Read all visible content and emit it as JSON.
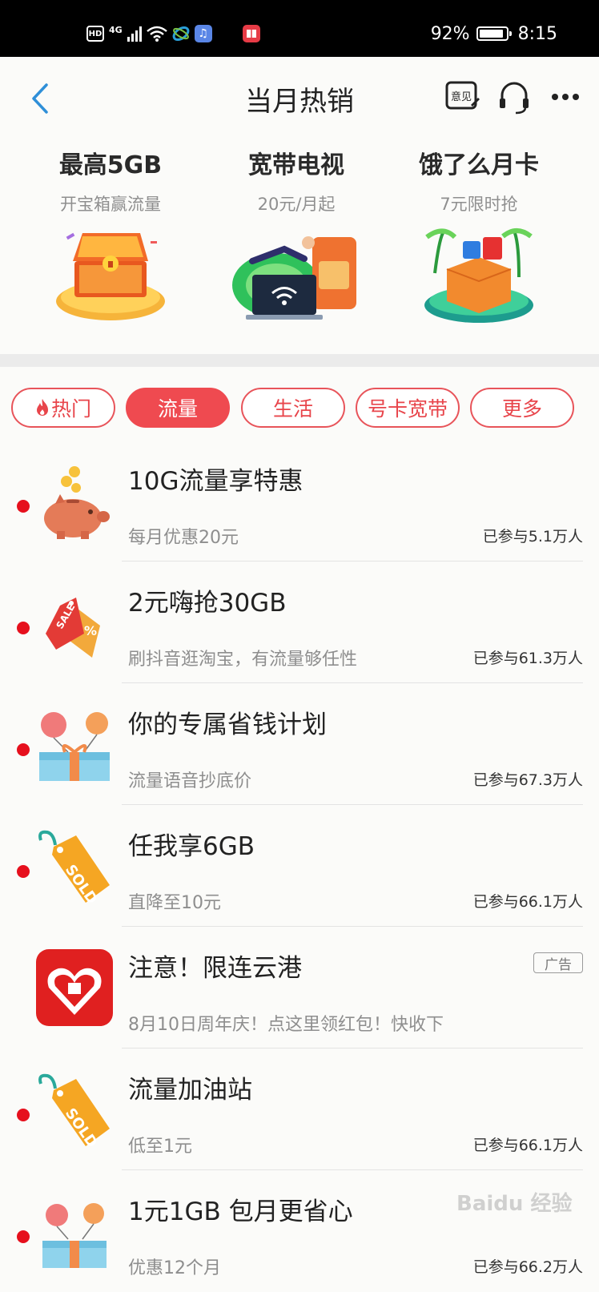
{
  "status_bar": {
    "left": [
      "HD",
      "4G"
    ],
    "battery": "92%",
    "battery_level": 0.92,
    "time": "8:15"
  },
  "header": {
    "title": "当月热销",
    "icons": [
      "back-icon",
      "feedback-icon",
      "headset-icon",
      "more-icon"
    ],
    "feedback_icon_text": "意见"
  },
  "promos": [
    {
      "title": "最高5GB",
      "subtitle": "开宝箱赢流量"
    },
    {
      "title": "宽带电视",
      "subtitle": "20元/月起"
    },
    {
      "title": "饿了么月卡",
      "subtitle": "7元限时抢"
    }
  ],
  "tabs": [
    {
      "label": "热门",
      "active": false,
      "icon": "flame-icon"
    },
    {
      "label": "流量",
      "active": true
    },
    {
      "label": "生活",
      "active": false
    },
    {
      "label": "号卡宽带",
      "active": false
    },
    {
      "label": "更多",
      "active": false
    }
  ],
  "items": [
    {
      "title": "10G流量享特惠",
      "desc": "每月优惠20元",
      "stat": "已参与5.1万人",
      "icon": "piggy-bank-icon"
    },
    {
      "title": "2元嗨抢30GB",
      "desc": "刷抖音逛淘宝，有流量够任性",
      "stat": "已参与61.3万人",
      "icon": "sale-tag-icon"
    },
    {
      "title": "你的专属省钱计划",
      "desc": "流量语音抄底价",
      "stat": "已参与67.3万人",
      "icon": "gift-balloons-icon"
    },
    {
      "title": "任我享6GB",
      "desc": "直降至10元",
      "stat": "已参与66.1万人",
      "icon": "sold-tag-icon"
    },
    {
      "title": "注意！限连云港",
      "desc": "8月10日周年庆！点这里领红包！快收下",
      "badge": "广告",
      "icon": "pinduoduo-logo-icon"
    },
    {
      "title": "流量加油站",
      "desc": "低至1元",
      "stat": "已参与66.1万人",
      "icon": "sold-tag-icon"
    },
    {
      "title": "1元1GB  包月更省心",
      "desc": "优惠12个月",
      "stat": "已参与66.2万人",
      "icon": "gift-balloons-icon"
    }
  ],
  "watermark": "Baidu 经验"
}
